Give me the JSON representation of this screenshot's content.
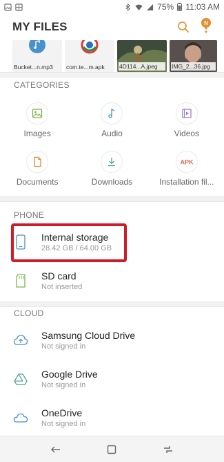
{
  "status_bar": {
    "battery": "75%",
    "time": "11:03 AM"
  },
  "app_bar": {
    "title": "MY FILES",
    "notification_badge": "N"
  },
  "recent_files": [
    {
      "name": "Bucket...n.mp3",
      "icon": "music-note-icon"
    },
    {
      "name": "com.te...m.apk",
      "icon": "app-icon"
    },
    {
      "name": "4D114...A.jpeg",
      "icon": "photo-thumbnail"
    },
    {
      "name": "IMG_2...36.jpg",
      "icon": "photo-thumbnail"
    }
  ],
  "categories": {
    "header": "CATEGORIES",
    "items": [
      {
        "label": "Images",
        "icon": "image-icon"
      },
      {
        "label": "Audio",
        "icon": "music-note-icon"
      },
      {
        "label": "Videos",
        "icon": "video-icon"
      },
      {
        "label": "Documents",
        "icon": "document-icon"
      },
      {
        "label": "Downloads",
        "icon": "download-icon"
      },
      {
        "label": "Installation fil...",
        "icon": "apk-icon"
      }
    ]
  },
  "phone": {
    "header": "PHONE",
    "items": [
      {
        "title": "Internal storage",
        "subtitle": "28.42 GB / 64.00 GB",
        "icon": "phone-icon"
      },
      {
        "title": "SD card",
        "subtitle": "Not inserted",
        "icon": "sd-card-icon"
      }
    ]
  },
  "cloud": {
    "header": "CLOUD",
    "items": [
      {
        "title": "Samsung Cloud Drive",
        "subtitle": "Not signed in",
        "icon": "samsung-cloud-icon"
      },
      {
        "title": "Google Drive",
        "subtitle": "Not signed in",
        "icon": "google-drive-icon"
      },
      {
        "title": "OneDrive",
        "subtitle": "Not signed in",
        "icon": "onedrive-icon"
      }
    ]
  },
  "colors": {
    "accent": "#e98c2c",
    "highlight": "#d11a28",
    "icon_blue": "#4a90c9",
    "icon_green": "#7cb34a"
  }
}
